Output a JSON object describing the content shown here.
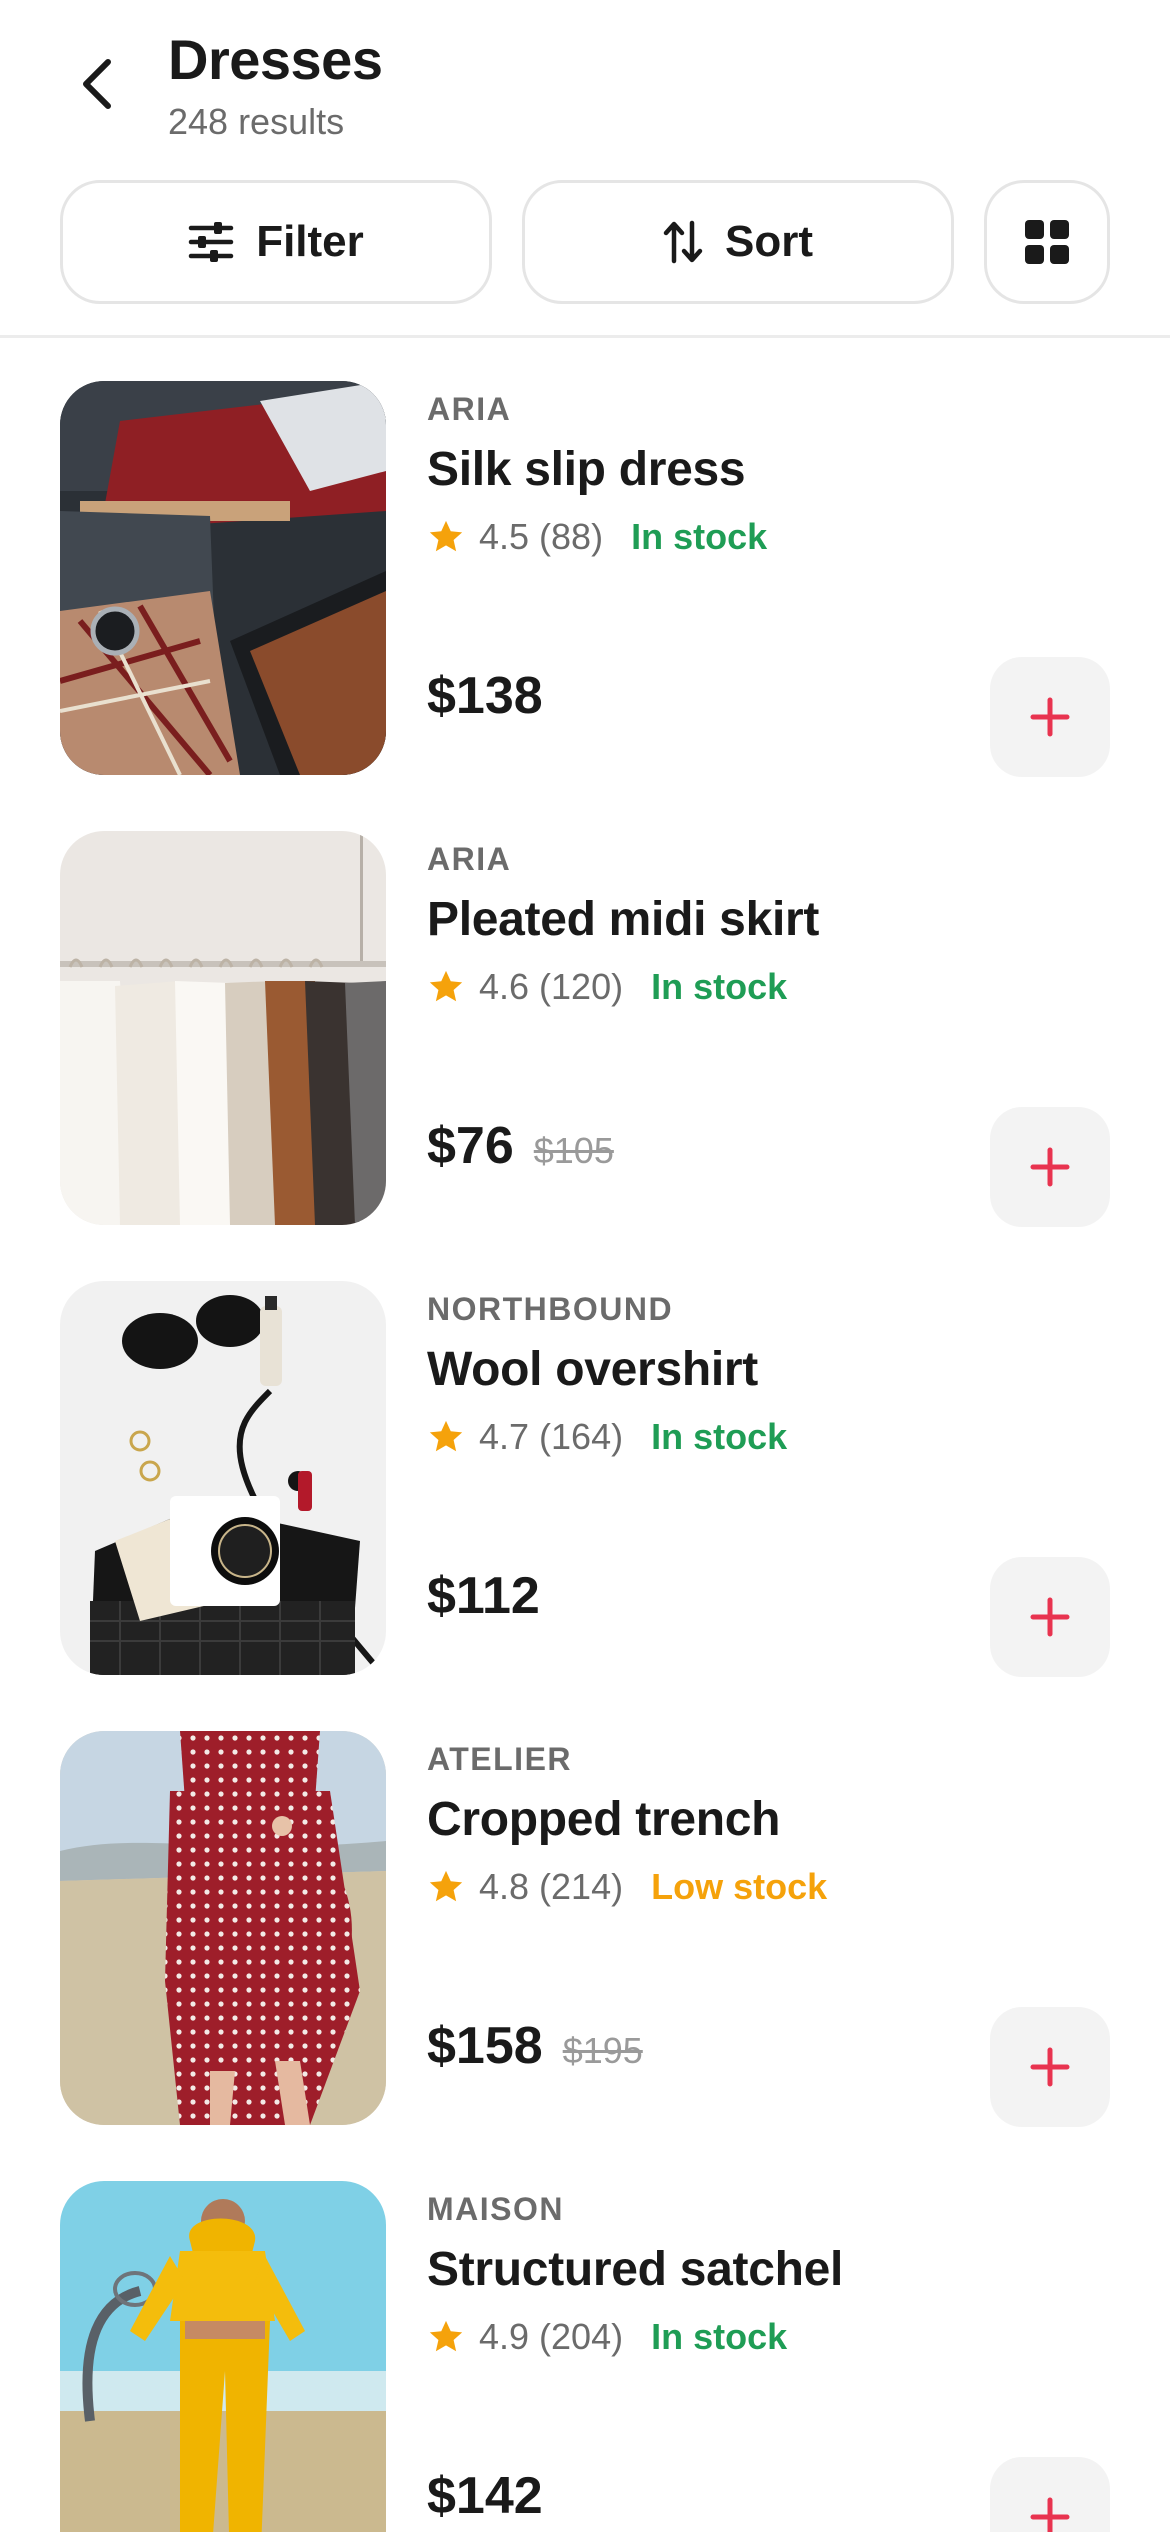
{
  "header": {
    "title": "Dresses",
    "results": "248 results"
  },
  "toolbar": {
    "filter_label": "Filter",
    "sort_label": "Sort"
  },
  "colors": {
    "accent": "#e8334f",
    "in_stock": "#1f9d55",
    "low_stock": "#f5a20b",
    "star": "#f5a20b"
  },
  "products": [
    {
      "brand": "ARIA",
      "name": "Silk slip dress",
      "rating": "4.5 (88)",
      "stock": "In stock",
      "price": "$138",
      "old_price": ""
    },
    {
      "brand": "ARIA",
      "name": "Pleated midi skirt",
      "rating": "4.6 (120)",
      "stock": "In stock",
      "price": "$76",
      "old_price": "$105"
    },
    {
      "brand": "NORTHBOUND",
      "name": "Wool overshirt",
      "rating": "4.7 (164)",
      "stock": "In stock",
      "price": "$112",
      "old_price": ""
    },
    {
      "brand": "ATELIER",
      "name": "Cropped trench",
      "rating": "4.8 (214)",
      "stock": "Low stock",
      "price": "$158",
      "old_price": "$195"
    },
    {
      "brand": "MAISON",
      "name": "Structured satchel",
      "rating": "4.9 (204)",
      "stock": "In stock",
      "price": "$142",
      "old_price": ""
    }
  ]
}
